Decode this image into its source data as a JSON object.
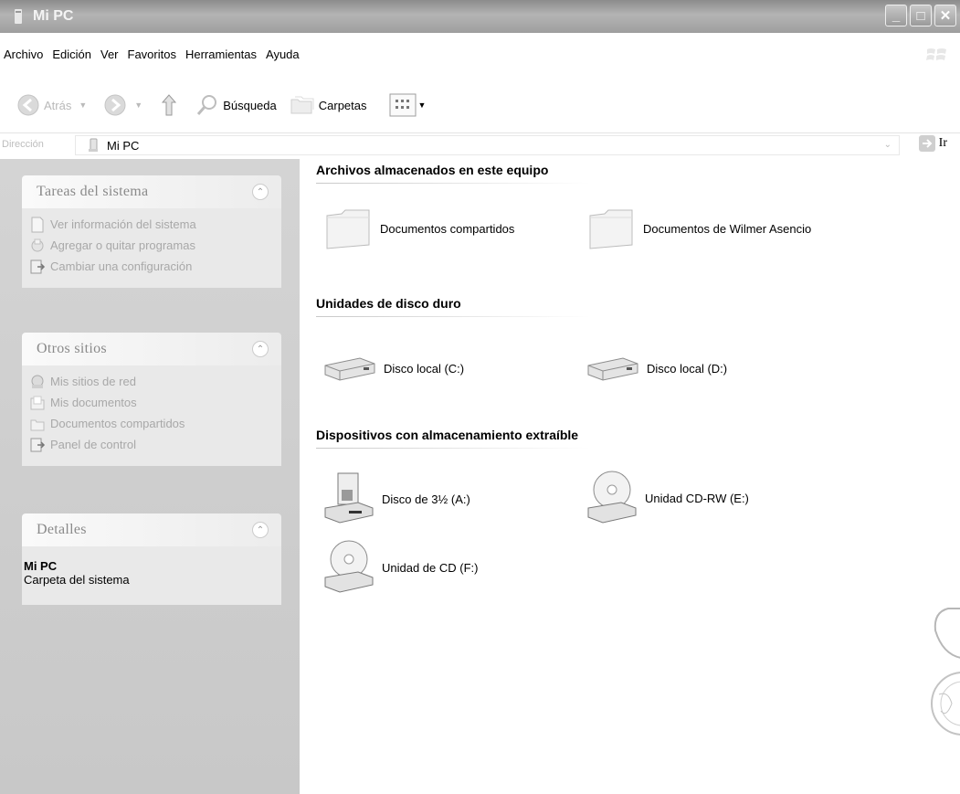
{
  "window": {
    "title": "Mi PC"
  },
  "menu": [
    "Archivo",
    "Edición",
    "Ver",
    "Favoritos",
    "Herramientas",
    "Ayuda"
  ],
  "toolbar": {
    "back_label": "Atrás",
    "search_label": "Búsqueda",
    "folders_label": "Carpetas"
  },
  "address": {
    "label": "Dirección",
    "value": "Mi PC",
    "go_label": "Ir"
  },
  "tasks_panel": {
    "title": "Tareas del sistema",
    "items": [
      "Ver información del sistema",
      "Agregar o quitar programas",
      "Cambiar una configuración"
    ]
  },
  "places_panel": {
    "title": "Otros sitios",
    "items": [
      "Mis sitios de red",
      "Mis documentos",
      "Documentos compartidos",
      "Panel de control"
    ]
  },
  "details_panel": {
    "title": "Detalles",
    "name": "Mi PC",
    "type": "Carpeta del sistema"
  },
  "sections": {
    "stored_files": {
      "header": "Archivos almacenados en este equipo",
      "items": [
        "Documentos compartidos",
        "Documentos de Wilmer Asencio"
      ]
    },
    "hard_drives": {
      "header": "Unidades de disco duro",
      "items": [
        "Disco local (C:)",
        "Disco local (D:)"
      ]
    },
    "removable": {
      "header": "Dispositivos con almacenamiento extraíble",
      "items": [
        "Disco de 3½ (A:)",
        "Unidad CD-RW (E:)",
        "Unidad de CD (F:)"
      ]
    }
  }
}
